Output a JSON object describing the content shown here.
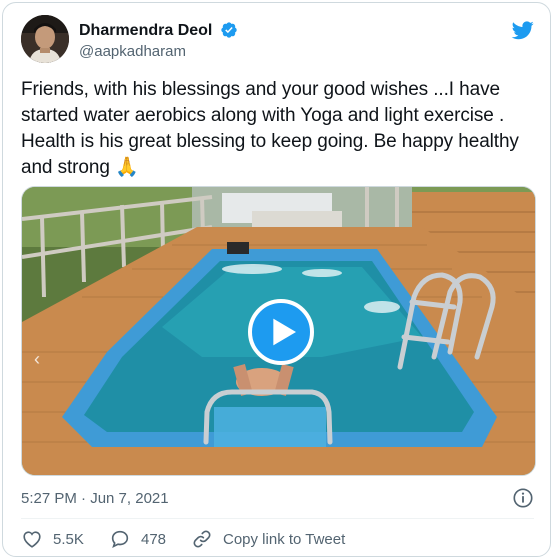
{
  "author": {
    "display_name": "Dharmendra Deol",
    "handle": "@aapkadharam",
    "verified": true
  },
  "tweet": {
    "text_lines": [
      "Friends, with his blessings and your good wishes ...I have",
      "started water aerobics along with Yoga and light exercise .",
      "Health is his great blessing to keep going. Be happy healthy",
      "and strong 🙏"
    ],
    "timestamp": "5:27 PM · Jun 7, 2021"
  },
  "actions": {
    "likes": "5.5K",
    "replies": "478",
    "copy_link_label": "Copy link to Tweet"
  },
  "colors": {
    "accent": "#1d9bf0",
    "like": "#f91880",
    "muted": "#536471",
    "pool_water": "#1f8fa6",
    "deck": "#c98a4e"
  },
  "icons": [
    "verified-badge-icon",
    "twitter-bird-icon",
    "play-icon",
    "info-icon",
    "heart-icon",
    "reply-icon",
    "link-icon"
  ]
}
